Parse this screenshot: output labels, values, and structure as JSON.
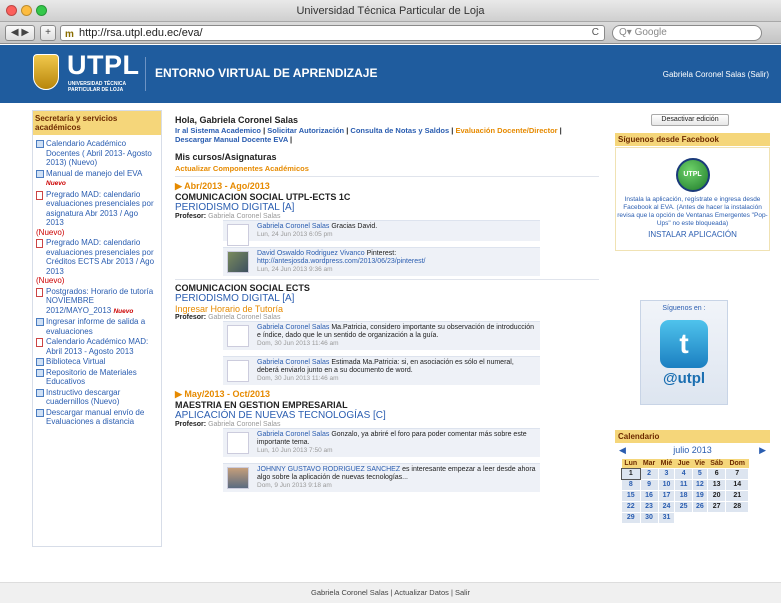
{
  "window": {
    "title": "Universidad Técnica Particular de Loja",
    "url": "http://rsa.utpl.edu.ec/eva/",
    "search_placeholder": "Q▾ Google",
    "add_tab": "+",
    "reload": "C"
  },
  "banner": {
    "logo": "UTPL",
    "logo_sub": "UNIVERSIDAD TÉCNICA PARTICULAR DE LOJA",
    "title": "ENTORNO VIRTUAL DE APRENDIZAJE",
    "user": "Gabriela Coronel Salas (Salir)",
    "bg": "#1f5c9e"
  },
  "left": {
    "header": "Secretaría y servicios académicos",
    "items": [
      {
        "label": "Calendario Académico Docentes ( Abril 2013- Agosto 2013) (Nuevo)"
      },
      {
        "label": "Manual de manejo del EVA",
        "badge": "Nuevo"
      },
      {
        "label": "Pregrado MAD: calendario evaluaciones presenciales por asignatura Abr 2013 / Ago 2013",
        "red": "(Nuevo)"
      },
      {
        "label": "Pregrado MAD: calendario evaluaciones presenciales por Créditos ECTS Abr 2013 / Ago 2013",
        "red": "(Nuevo)"
      },
      {
        "label": "Postgrados: Horario de tutoría NOVIEMBRE 2012/MAYO_2013",
        "badge": "Nuevo"
      },
      {
        "label": "Ingresar informe de salida a evaluaciones"
      },
      {
        "label": "Calendario Académico MAD: Abril 2013 - Agosto 2013"
      },
      {
        "label": "Biblioteca Virtual"
      },
      {
        "label": "Repositorio de Materiales Educativos"
      },
      {
        "label": "Instructivo descargar cuadernillos (Nuevo)"
      },
      {
        "label": "Descargar manual envío de Evaluaciones a distancia"
      }
    ]
  },
  "center": {
    "greeting": "Hola, Gabriela Coronel Salas",
    "links": {
      "l1": "Ir al Sistema Academico",
      "l2": "Solicitar Autorización",
      "l3": "Consulta de Notas y Saldos",
      "l4": "Evaluación Docente/Director",
      "l5": "Descargar Manual Docente EVA",
      "sep": " | "
    },
    "courses_title": "Mis cursos/Asignaturas",
    "update": "Actualizar Componentes Académicos",
    "period1": "▶ Abr/2013 - Ago/2013",
    "period2": "▶ May/2013 - Oct/2013",
    "prof_label": "Profesor:",
    "prof_name": "Gabriela Coronel Salas",
    "c1": {
      "name": "COMUNICACION SOCIAL UTPL-ECTS 1C",
      "subject": "PERIODISMO DIGITAL [A]",
      "p1": {
        "author": "Gabriela Coronel Salas",
        "text": "Gracias David.",
        "date": "Lun, 24 Jun 2013 6:05 pm"
      },
      "p2": {
        "author": "David Oswaldo Rodriguez Vivanco",
        "text": "Pinterest:",
        "link": "http://antesjosda.wordpress.com/2013/06/23/pinterest/",
        "date": "Lun, 24 Jun 2013 9:36 am"
      }
    },
    "c2": {
      "name": "COMUNICACION SOCIAL ECTS",
      "subject": "PERIODISMO DIGITAL [A]",
      "extra": "Ingresar Horario de Tutoría",
      "p1": {
        "author": "Gabriela Coronel Salas",
        "text": "Ma.Patricia, considero importante su observación de introducción e índice, dado que le un sentido de organización a la guía.",
        "date": "Dom, 30 Jun 2013 11:46 am"
      },
      "p2": {
        "author": "Gabriela Coronel Salas",
        "text": "Estimada Ma.Patricia: si, en asociación es sólo el numeral, deberá enviarlo junto en a su documento de word.",
        "date": "Dom, 30 Jun 2013 11:46 am"
      }
    },
    "c3": {
      "name": "MAESTRIA EN GESTION EMPRESARIAL",
      "subject": "APLICACIÓN DE NUEVAS TECNOLOGÍAS [C]",
      "p1": {
        "author": "Gabriela Coronel Salas",
        "text": "Gonzalo, ya abriré el foro para poder comentar más sobre este importante tema.",
        "date": "Lun, 10 Jun 2013 7:50 am"
      },
      "p2": {
        "author": "JOHNNY GUSTAVO RODRIGUEZ SANCHEZ",
        "text": "es interesante empezar a leer desde ahora algo sobre la aplicación de nuevas tecnologías...",
        "date": "Dom, 9 Jun 2013 9:18 am"
      }
    }
  },
  "right": {
    "deactivate": "Desactivar edición",
    "fb_header": "Síguenos desde Facebook",
    "eva_icon": "UTPL",
    "fb_text": "Instala la aplicación, regístrate e ingresa desde Facebook al EVA. (Antes de hacer la instalación revisa que la opción de Ventanas Emergentes \"Pop-Ups\" no este bloqueada)",
    "install": "INSTALAR APLICACIÓN",
    "follow": "Síguenos en :",
    "twitter_glyph": "t",
    "at": "@utpl",
    "cal_header": "Calendario",
    "cal_month": "julio 2013",
    "cal_prev": "◀",
    "cal_next": "▶",
    "days": [
      "Lun",
      "Mar",
      "Mié",
      "Jue",
      "Vie",
      "Sáb",
      "Dom"
    ],
    "weeks": [
      [
        "1",
        "2",
        "3",
        "4",
        "5",
        "6",
        "7"
      ],
      [
        "8",
        "9",
        "10",
        "11",
        "12",
        "13",
        "14"
      ],
      [
        "15",
        "16",
        "17",
        "18",
        "19",
        "20",
        "21"
      ],
      [
        "22",
        "23",
        "24",
        "25",
        "26",
        "27",
        "28"
      ],
      [
        "29",
        "30",
        "31",
        "",
        "",
        "",
        ""
      ]
    ]
  },
  "footer": {
    "text": "Gabriela Coronel Salas  |  Actualizar Datos  |  Salir"
  }
}
